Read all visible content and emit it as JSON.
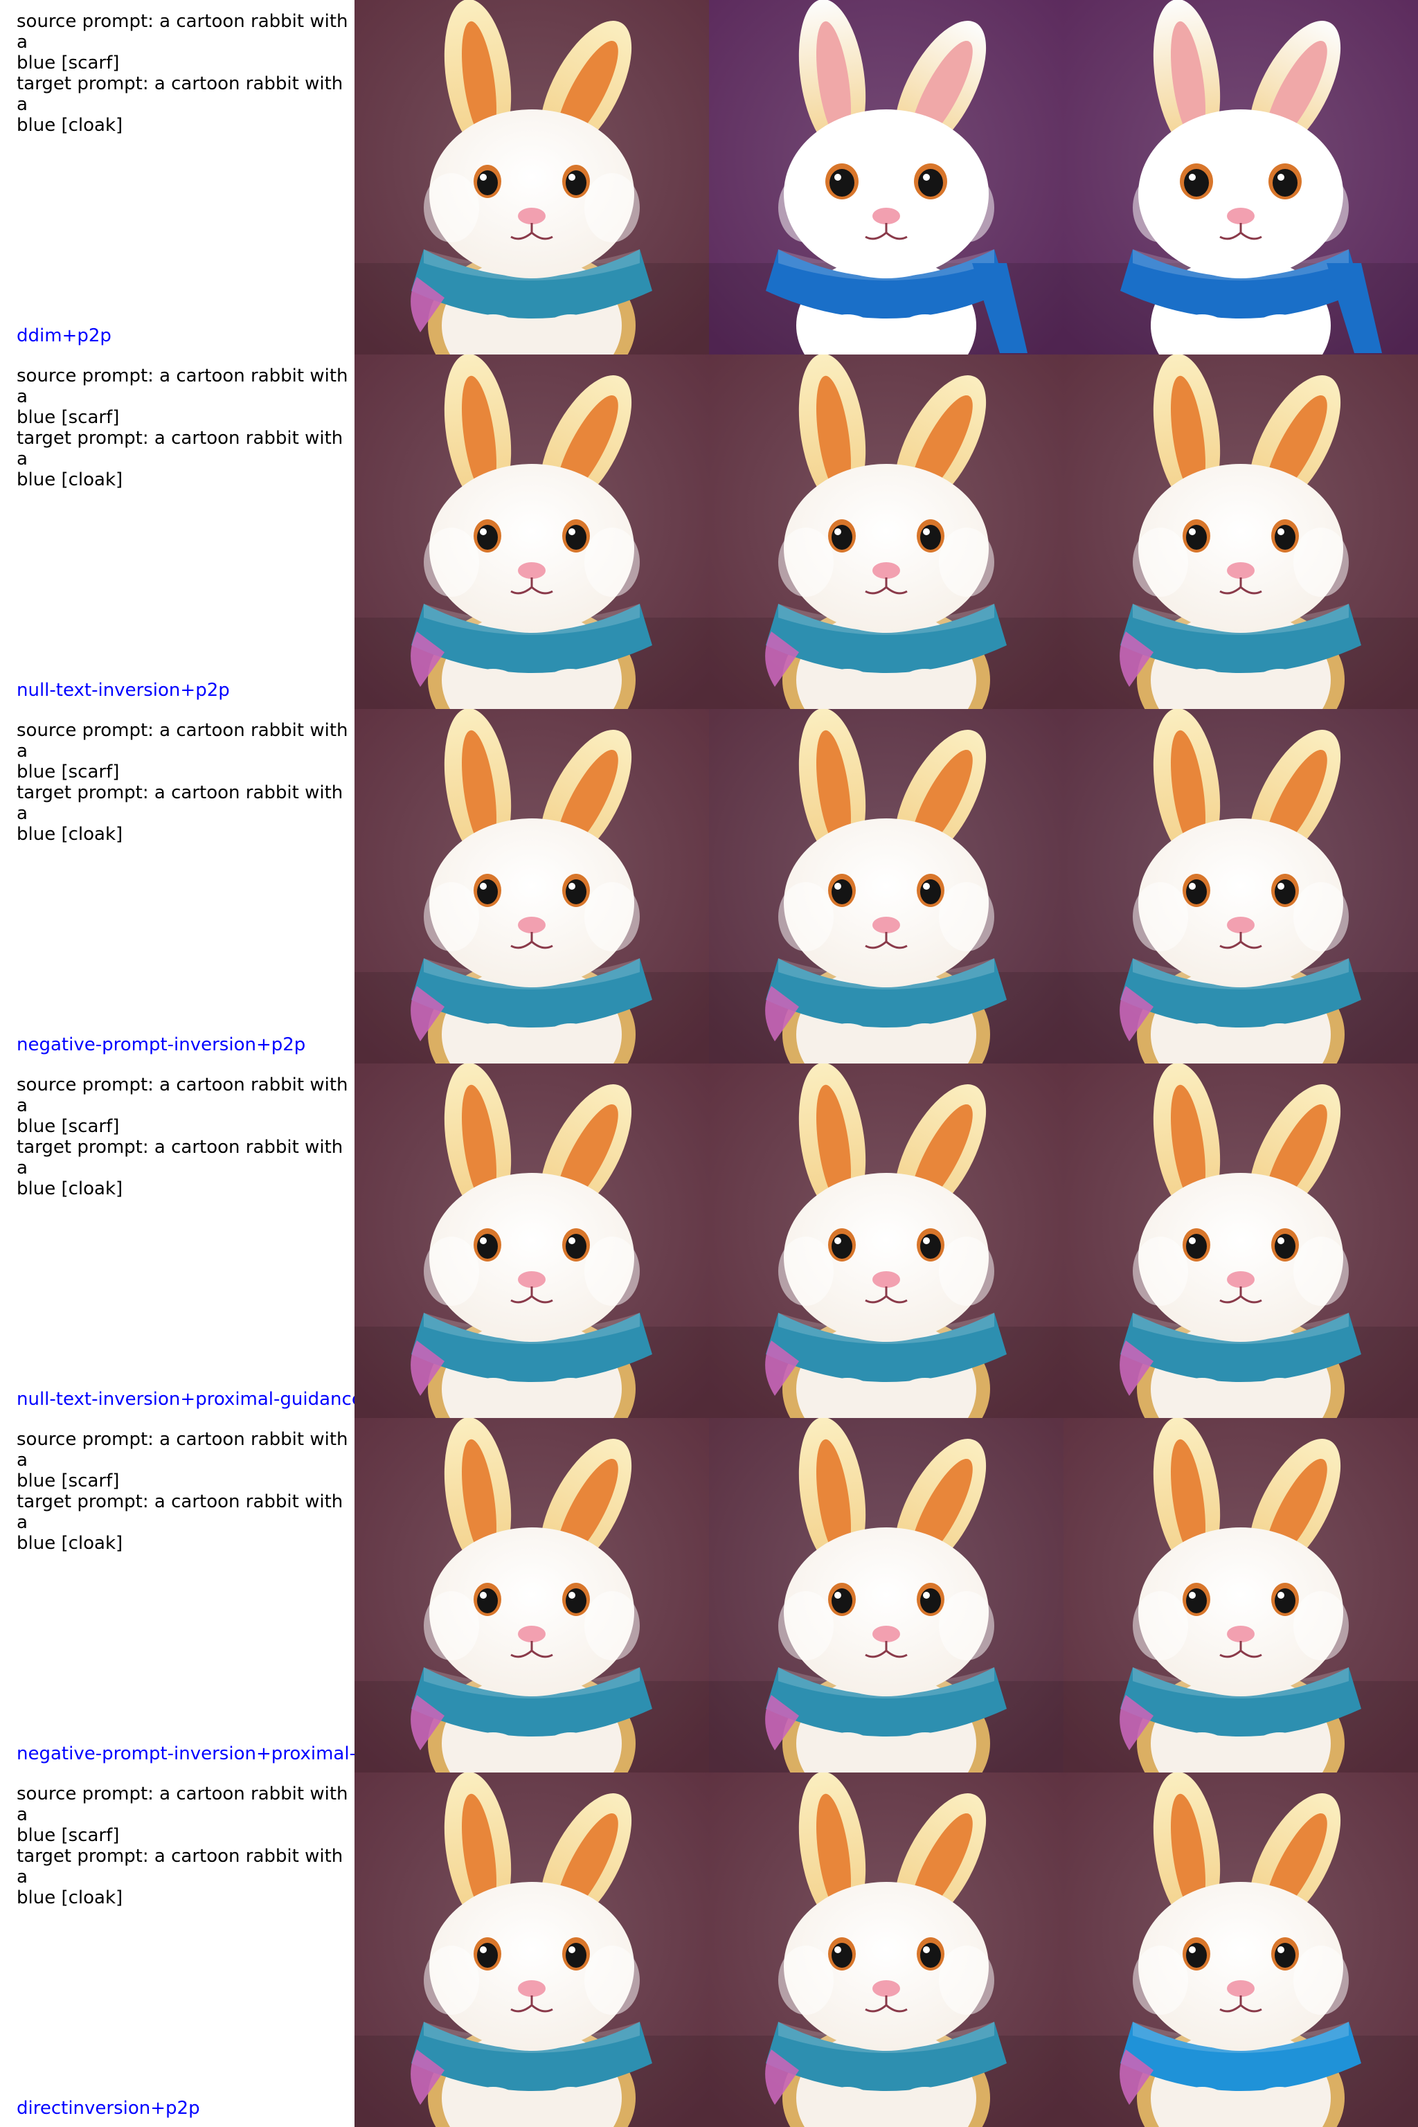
{
  "source_prompt_line1": "source prompt: a cartoon rabbit with a",
  "source_prompt_line2": "blue [scarf]",
  "target_prompt_line1": "target prompt: a cartoon rabbit with a",
  "target_prompt_line2": "blue [cloak]",
  "colors": {
    "method_label": "#0000ff",
    "prompt_text": "#000000",
    "background_maroon": "#5e3140",
    "background_purple": "#5b2a5c",
    "scarf_teal": "#2d8fb0",
    "scarf_blue": "#1a6fc8",
    "fur_white": "#f7f1ea"
  },
  "rows": [
    {
      "method": "ddim+p2p",
      "images": [
        {
          "variant": "original",
          "background": "#5e3140",
          "scarf": "#2d8fb0"
        },
        {
          "variant": "edited-ddim",
          "background": "#5b2a5c",
          "scarf": "#1a6fc8"
        },
        {
          "variant": "edited-ddim",
          "background": "#5b2a5c",
          "scarf": "#1a6fc8"
        }
      ]
    },
    {
      "method": "null-text-inversion+p2p",
      "images": [
        {
          "variant": "original",
          "background": "#5e3140",
          "scarf": "#2d8fb0"
        },
        {
          "variant": "reconstruction",
          "background": "#5e3140",
          "scarf": "#2d8fb0"
        },
        {
          "variant": "edited",
          "background": "#5e3140",
          "scarf": "#2d8fb0"
        }
      ]
    },
    {
      "method": "negative-prompt-inversion+p2p",
      "images": [
        {
          "variant": "original",
          "background": "#5e3140",
          "scarf": "#2d8fb0"
        },
        {
          "variant": "reconstruction",
          "background": "#5a3042",
          "scarf": "#2d8fb0"
        },
        {
          "variant": "edited",
          "background": "#5a3042",
          "scarf": "#2d8fb0"
        }
      ]
    },
    {
      "method": "null-text-inversion+proximal-guidance",
      "images": [
        {
          "variant": "original",
          "background": "#5e3140",
          "scarf": "#2d8fb0"
        },
        {
          "variant": "reconstruction",
          "background": "#5e3140",
          "scarf": "#2d8fb0"
        },
        {
          "variant": "edited",
          "background": "#5e3140",
          "scarf": "#2d8fb0"
        }
      ]
    },
    {
      "method": "negative-prompt-inversion+proximal-g",
      "images": [
        {
          "variant": "original",
          "background": "#5e3140",
          "scarf": "#2d8fb0"
        },
        {
          "variant": "reconstruction",
          "background": "#5a3042",
          "scarf": "#2d8fb0"
        },
        {
          "variant": "edited",
          "background": "#5e3140",
          "scarf": "#2d8fb0"
        }
      ]
    },
    {
      "method": "directinversion+p2p",
      "images": [
        {
          "variant": "original",
          "background": "#5e3140",
          "scarf": "#2d8fb0"
        },
        {
          "variant": "reconstruction",
          "background": "#5e3140",
          "scarf": "#2d8fb0"
        },
        {
          "variant": "edited",
          "background": "#5e3140",
          "scarf": "#1f92d8"
        }
      ]
    }
  ]
}
